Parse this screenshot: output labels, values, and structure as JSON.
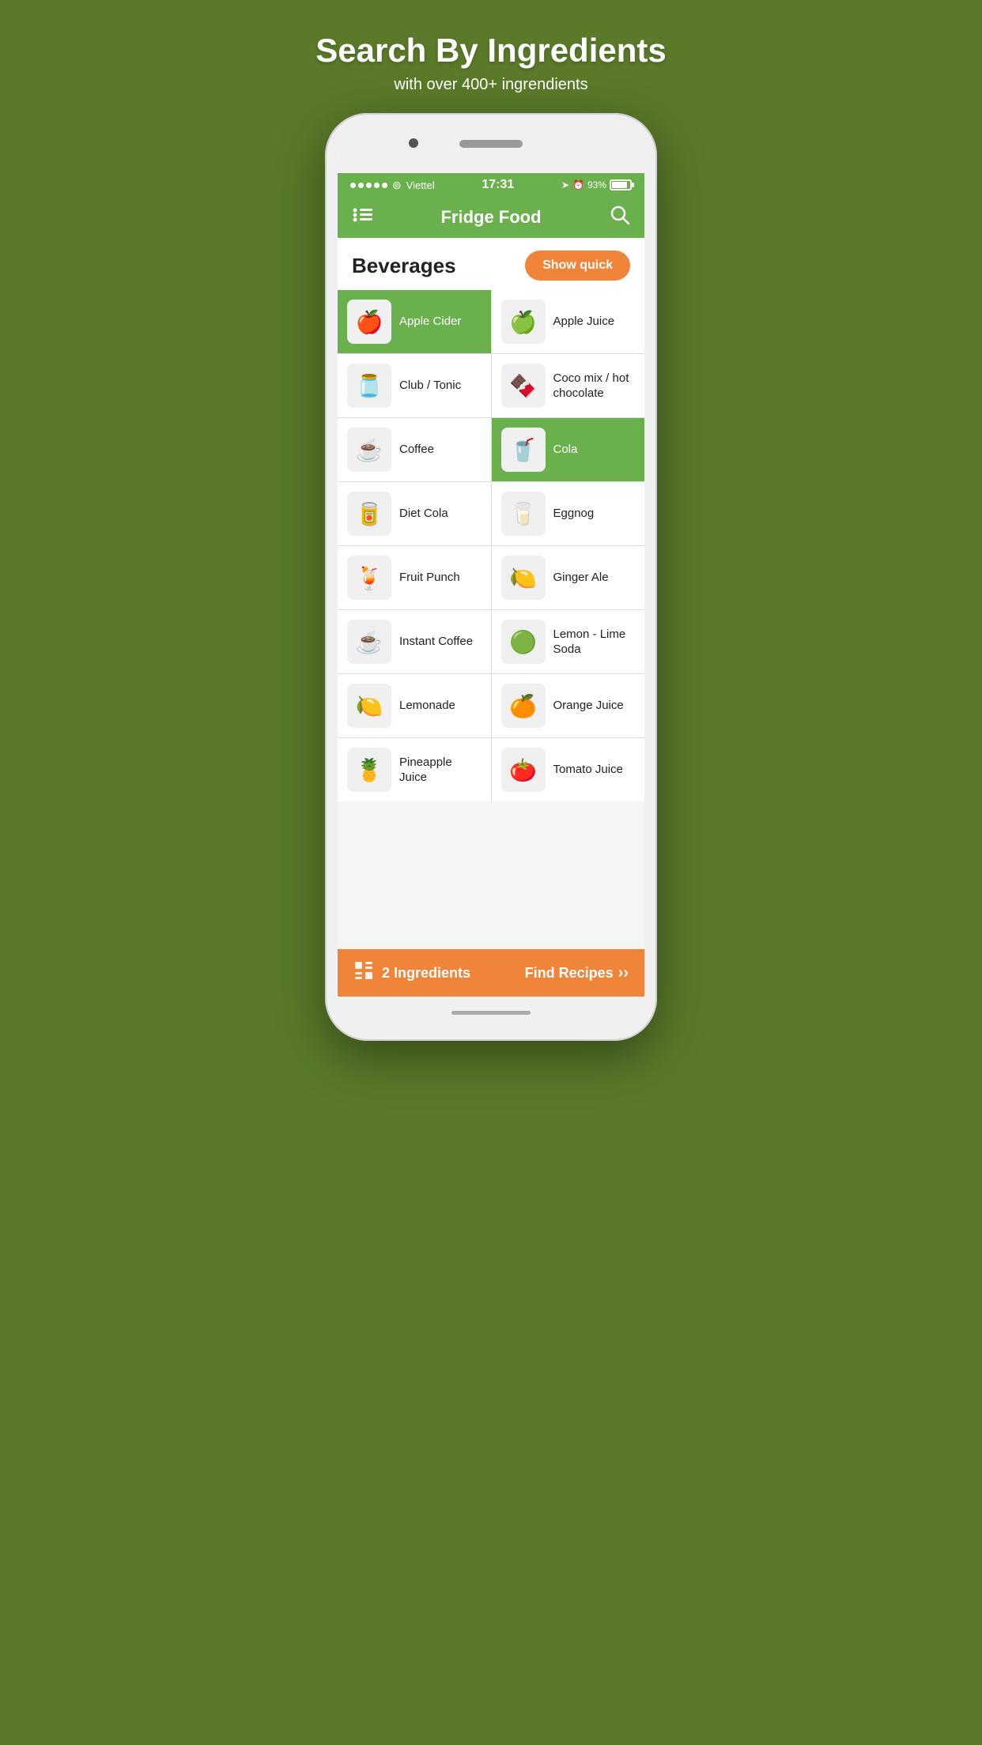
{
  "page": {
    "title": "Search By Ingredients",
    "subtitle": "with over 400+ ingrendients"
  },
  "status_bar": {
    "carrier": "Viettel",
    "time": "17:31",
    "battery": "93%"
  },
  "nav": {
    "title": "Fridge Food"
  },
  "section": {
    "title": "Beverages",
    "show_quick_label": "Show quick"
  },
  "items": [
    {
      "id": 1,
      "label": "Apple Cider",
      "emoji": "🍎",
      "selected": true
    },
    {
      "id": 2,
      "label": "Apple Juice",
      "emoji": "🍏",
      "selected": false
    },
    {
      "id": 3,
      "label": "Club / Tonic",
      "emoji": "🫙",
      "selected": false
    },
    {
      "id": 4,
      "label": "Coco mix / hot chocolate",
      "emoji": "🍫",
      "selected": false
    },
    {
      "id": 5,
      "label": "Coffee",
      "emoji": "☕",
      "selected": false
    },
    {
      "id": 6,
      "label": "Cola",
      "emoji": "🥤",
      "selected": true
    },
    {
      "id": 7,
      "label": "Diet Cola",
      "emoji": "🥫",
      "selected": false
    },
    {
      "id": 8,
      "label": "Eggnog",
      "emoji": "🥛",
      "selected": false
    },
    {
      "id": 9,
      "label": "Fruit Punch",
      "emoji": "🍹",
      "selected": false
    },
    {
      "id": 10,
      "label": "Ginger Ale",
      "emoji": "🍋",
      "selected": false
    },
    {
      "id": 11,
      "label": "Instant Coffee",
      "emoji": "☕",
      "selected": false
    },
    {
      "id": 12,
      "label": "Lemon - Lime Soda",
      "emoji": "🟢",
      "selected": false
    },
    {
      "id": 13,
      "label": "Lemonade",
      "emoji": "🍋",
      "selected": false
    },
    {
      "id": 14,
      "label": "Orange Juice",
      "emoji": "🍊",
      "selected": false
    },
    {
      "id": 15,
      "label": "Pineapple Juice",
      "emoji": "🍍",
      "selected": false
    },
    {
      "id": 16,
      "label": "Tomato Juice",
      "emoji": "🍅",
      "selected": false
    }
  ],
  "bottom_bar": {
    "ingredients_count": "2 Ingredients",
    "find_recipes_label": "Find Recipes"
  }
}
